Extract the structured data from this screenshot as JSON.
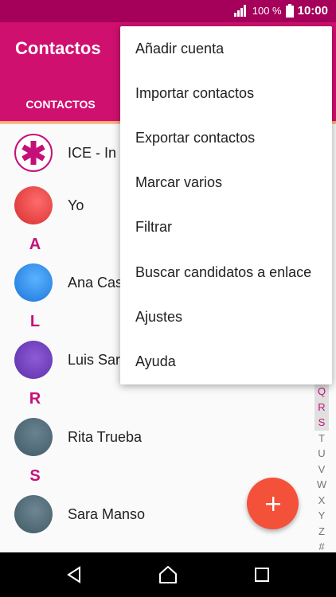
{
  "status": {
    "battery": "100 %",
    "time": "10:00"
  },
  "app": {
    "title": "Contactos",
    "tab": "CONTACTOS"
  },
  "contacts": [
    {
      "name": "ICE - In C"
    },
    {
      "name": "Yo"
    },
    {
      "section": "A"
    },
    {
      "name": "Ana Cas"
    },
    {
      "section": "L"
    },
    {
      "name": "Luis Sar"
    },
    {
      "section": "R"
    },
    {
      "name": "Rita Trueba"
    },
    {
      "section": "S"
    },
    {
      "name": "Sara Manso"
    }
  ],
  "index": [
    "Q",
    "R",
    "S",
    "T",
    "U",
    "V",
    "W",
    "X",
    "Y",
    "Z",
    "#"
  ],
  "menu": [
    "Añadir cuenta",
    "Importar contactos",
    "Exportar contactos",
    "Marcar varios",
    "Filtrar",
    "Buscar candidatos a enlace",
    "Ajustes",
    "Ayuda"
  ],
  "colors": {
    "accent": "#d0106f",
    "fab": "#f4513b"
  }
}
